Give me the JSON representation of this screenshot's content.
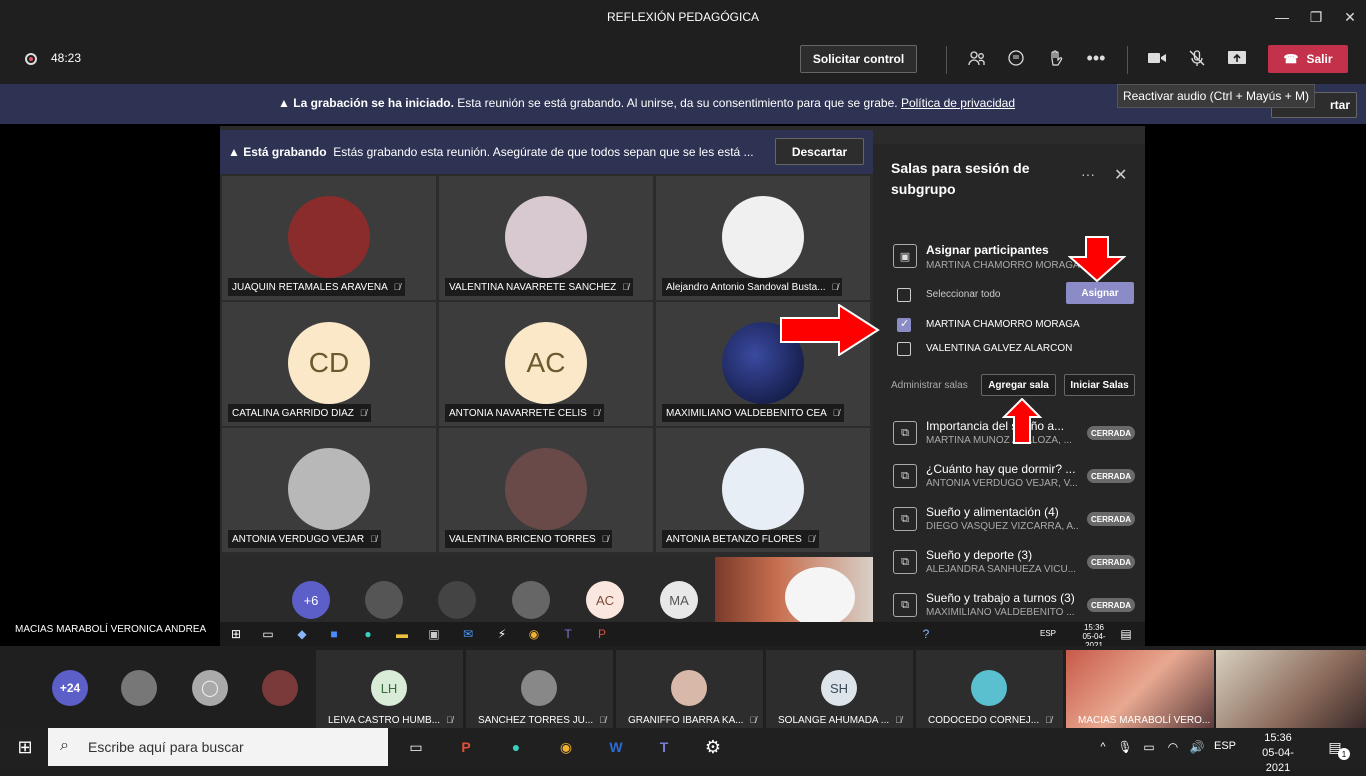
{
  "window": {
    "title": "REFLEXIÓN PEDAGÓGICA"
  },
  "toolbar": {
    "timer": "48:23",
    "request_control_label": "Solicitar control",
    "leave_label": "Salir"
  },
  "banner": {
    "bold": "La grabación se ha iniciado.",
    "text": "Esta reunión se está grabando. Al unirse, da su consentimiento para que se grabe.",
    "link": "Política de privacidad",
    "dismiss_label": "rtar"
  },
  "tooltip": "Reactivar audio (Ctrl + Mayús + M)",
  "shared": {
    "banner_bold": "Está grabando",
    "banner_text": "Estás grabando esta reunión. Asegúrate de que todos sepan que se les está ...",
    "dismiss_label": "Descartar",
    "participants": [
      {
        "name": "JUAQUIN RETAMALES ARAVENA",
        "initials": "",
        "color": "#8a2c2c"
      },
      {
        "name": "VALENTINA NAVARRETE SANCHEZ",
        "initials": "",
        "color": "#d8c8d0"
      },
      {
        "name": "Alejandro Antonio Sandoval Busta...",
        "initials": "",
        "color": "#f0f0f0"
      },
      {
        "name": "CATALINA GARRIDO DIAZ",
        "initials": "CD",
        "color": "#fae8c8"
      },
      {
        "name": "ANTONIA NAVARRETE CELIS",
        "initials": "AC",
        "color": "#fae8c8"
      },
      {
        "name": "MAXIMILIANO VALDEBENITO CEA",
        "initials": "",
        "color": "#1a2a5a"
      },
      {
        "name": "ANTONIA VERDUGO VEJAR",
        "initials": "",
        "color": "#b8b8b8"
      },
      {
        "name": "VALENTINA BRICENO TORRES",
        "initials": "",
        "color": "#6a4a48"
      },
      {
        "name": "ANTONIA BETANZO FLORES",
        "initials": "",
        "color": "#e8eef5"
      }
    ],
    "strip": [
      {
        "label": "+6",
        "color": "#5b5fc7"
      },
      {
        "label": "",
        "color": "#555"
      },
      {
        "label": "",
        "color": "#444"
      },
      {
        "label": "",
        "color": "#666"
      },
      {
        "label": "AC",
        "color": "#fae8e0"
      },
      {
        "label": "MA",
        "color": "#e8e8e8"
      }
    ],
    "presenter_name": "MACIAS MARABOLÍ VERONICA ANDREA",
    "inner_clock_time": "15:36",
    "inner_clock_date": "05-04-2021",
    "inner_lang": "ESP"
  },
  "panel": {
    "title": "Salas para sesión de subgrupo",
    "assign_title": "Asignar participantes",
    "assign_sub": "MARTINA CHAMORRO MORAGA",
    "select_all": "Seleccionar todo",
    "assign_button": "Asignar",
    "people": [
      {
        "name": "MARTINA CHAMORRO MORAGA",
        "checked": true
      },
      {
        "name": "VALENTINA GALVEZ ALARCON",
        "checked": false
      }
    ],
    "manage_label": "Administrar salas",
    "add_room": "Agregar sala",
    "start_rooms": "Iniciar Salas",
    "rooms": [
      {
        "name": "Importancia del sueño a...",
        "sub": "MARTINA MUNOZ ABALOZA, ...",
        "status": "CERRADA"
      },
      {
        "name": "¿Cuánto hay que dormir? ...",
        "sub": "ANTONIA VERDUGO VEJAR, V...",
        "status": "CERRADA"
      },
      {
        "name": "Sueño y alimentación (4)",
        "sub": "DIEGO VASQUEZ VIZCARRA, A...",
        "status": "CERRADA"
      },
      {
        "name": "Sueño y deporte (3)",
        "sub": "ALEJANDRA SANHUEZA VICU...",
        "status": "CERRADA"
      },
      {
        "name": "Sueño y trabajo a turnos (3)",
        "sub": "MAXIMILIANO VALDEBENITO ...",
        "status": "CERRADA"
      }
    ]
  },
  "gallery": {
    "overflow": "+24",
    "tiles": [
      {
        "name": "LEIVA CASTRO HUMB...",
        "initials": "LH",
        "color": "#d8ecd8"
      },
      {
        "name": "SANCHEZ TORRES JU...",
        "initials": "",
        "color": "#888"
      },
      {
        "name": "GRANIFFO IBARRA KA...",
        "initials": "",
        "color": "#d8b8a8"
      },
      {
        "name": "SOLANGE AHUMADA ...",
        "initials": "SH",
        "color": "#dde4ea"
      },
      {
        "name": "CODOCEDO CORNEJ...",
        "initials": "",
        "color": "#5ac0d0"
      }
    ],
    "video_name": "MACIAS MARABOLÍ VERO..."
  },
  "taskbar": {
    "search_placeholder": "Escribe aquí para buscar",
    "lang": "ESP",
    "time": "15:36",
    "date": "05-04-2021",
    "notifications": "1"
  }
}
